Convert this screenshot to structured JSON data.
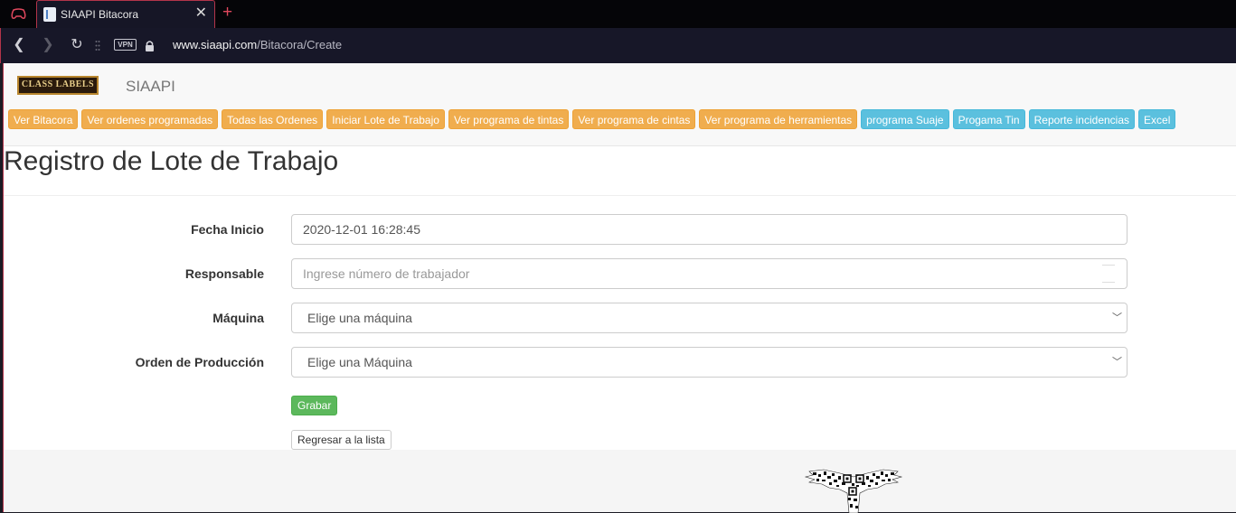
{
  "browser": {
    "tab_title": "SIAAPI Bitacora",
    "vpn_label": "VPN",
    "url_domain": "www.siaapi.com",
    "url_path": "/Bitacora/Create"
  },
  "navbar": {
    "logo_text": "CLASS LABELS",
    "brand": "SIAAPI",
    "menu": [
      {
        "label": "Ver Bitacora",
        "style": "warning"
      },
      {
        "label": "Ver ordenes programadas",
        "style": "warning"
      },
      {
        "label": "Todas las Ordenes",
        "style": "warning"
      },
      {
        "label": "Iniciar Lote de Trabajo",
        "style": "warning"
      },
      {
        "label": "Ver programa de tintas",
        "style": "warning"
      },
      {
        "label": "Ver programa de cintas",
        "style": "warning"
      },
      {
        "label": "Ver programa de herramientas",
        "style": "warning"
      },
      {
        "label": "programa Suaje",
        "style": "info"
      },
      {
        "label": "Progama Tin",
        "style": "info"
      },
      {
        "label": "Reporte incidencias",
        "style": "info"
      },
      {
        "label": "Excel",
        "style": "info"
      }
    ]
  },
  "page_title": "Registro de Lote de Trabajo",
  "form": {
    "fecha_inicio": {
      "label": "Fecha Inicio",
      "value": "2020-12-01 16:28:45"
    },
    "responsable": {
      "label": "Responsable",
      "placeholder": "Ingrese número de trabajador"
    },
    "maquina": {
      "label": "Máquina",
      "selected": "Elige una máquina"
    },
    "orden": {
      "label": "Orden de Producción",
      "selected": "Elige una Máquina"
    },
    "submit_label": "Grabar",
    "back_label": "Regresar a la lista"
  },
  "colors": {
    "warning": "#f0ad4e",
    "info": "#5bc0de",
    "success": "#5cb85c",
    "tab_accent": "#b3344a"
  }
}
